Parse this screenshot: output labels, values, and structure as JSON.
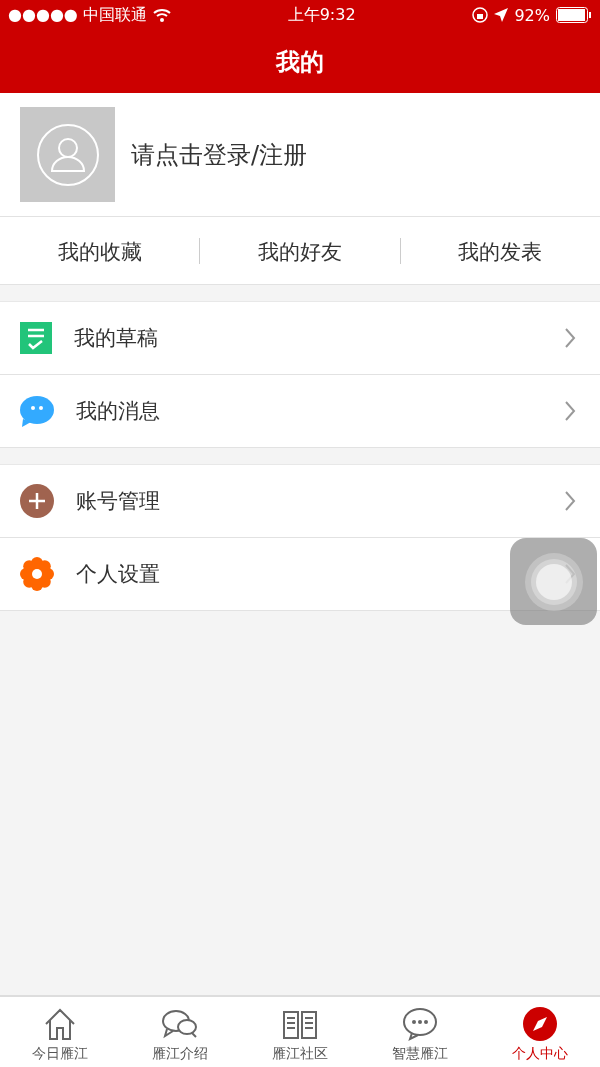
{
  "status_bar": {
    "carrier": "●●●●● 中国联通",
    "time": "上午9:32",
    "battery": "92%"
  },
  "header": {
    "title": "我的"
  },
  "profile": {
    "login_prompt": "请点击登录/注册"
  },
  "quick_links": [
    "我的收藏",
    "我的好友",
    "我的发表"
  ],
  "menu_groups": [
    [
      {
        "kind": "drafts",
        "label": "我的草稿"
      },
      {
        "kind": "messages",
        "label": "我的消息"
      }
    ],
    [
      {
        "kind": "account",
        "label": "账号管理"
      },
      {
        "kind": "settings",
        "label": "个人设置"
      }
    ]
  ],
  "tab_bar": [
    {
      "kind": "home",
      "label": "今日雁江",
      "selected": false
    },
    {
      "kind": "chat",
      "label": "雁江介绍",
      "selected": false
    },
    {
      "kind": "book",
      "label": "雁江社区",
      "selected": false
    },
    {
      "kind": "bubble",
      "label": "智慧雁江",
      "selected": false
    },
    {
      "kind": "compass",
      "label": "个人中心",
      "selected": true
    }
  ]
}
